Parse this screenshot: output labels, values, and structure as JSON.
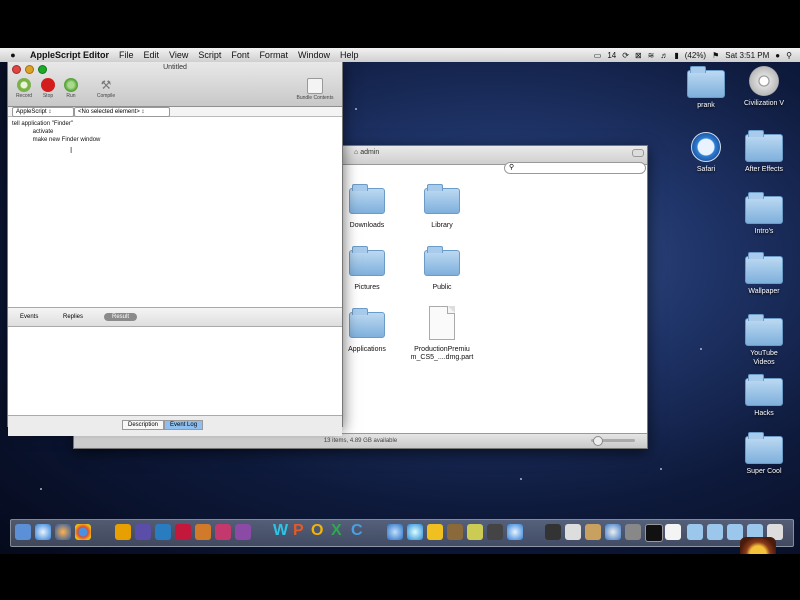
{
  "menubar": {
    "apple": "",
    "items": [
      "AppleScript Editor",
      "File",
      "Edit",
      "View",
      "Script",
      "Font",
      "Format",
      "Window",
      "Help"
    ],
    "status": {
      "display": "14",
      "battery": "(42%)",
      "clock": "Sat 3:51 PM"
    }
  },
  "desktop_icons": [
    {
      "label": "prank",
      "icon": "folder-icon"
    },
    {
      "label": "Civilization V",
      "icon": "disc-icon"
    },
    {
      "label": "Safari",
      "icon": "safari-icon"
    },
    {
      "label": "After Effects",
      "icon": "folder-icon"
    },
    {
      "label": "Intro's",
      "icon": "folder-icon"
    },
    {
      "label": "Wallpaper",
      "icon": "folder-icon"
    },
    {
      "label": "YouTube Videos",
      "icon": "folder-icon"
    },
    {
      "label": "Hacks",
      "icon": "folder-icon"
    },
    {
      "label": "Super Cool",
      "icon": "folder-icon"
    }
  ],
  "finder": {
    "title": "admin",
    "items": [
      {
        "label": "Downloads",
        "icon": "folder-icon"
      },
      {
        "label": "Library",
        "icon": "folder-icon"
      },
      {
        "label": "Pictures",
        "icon": "folder-icon"
      },
      {
        "label": "Public",
        "icon": "folder-icon"
      },
      {
        "label": "Applications",
        "icon": "folder-icon"
      },
      {
        "label": "ProductionPremiu m_CS5_....dmg.part",
        "icon": "document-icon"
      }
    ],
    "status": "13 items, 4.89 GB available"
  },
  "editor": {
    "title": "Untitled",
    "toolbar": [
      "Record",
      "Stop",
      "Run",
      "Compile",
      "Bundle Contents"
    ],
    "language_popup": "AppleScript",
    "element_popup": "<No selected element>",
    "code": [
      "tell application \"Finder\"",
      "    activate",
      "    make new Finder window"
    ],
    "result_tabs": [
      "Events",
      "Replies",
      "Result"
    ],
    "bottom_tabs": [
      "Description",
      "Event Log"
    ]
  }
}
